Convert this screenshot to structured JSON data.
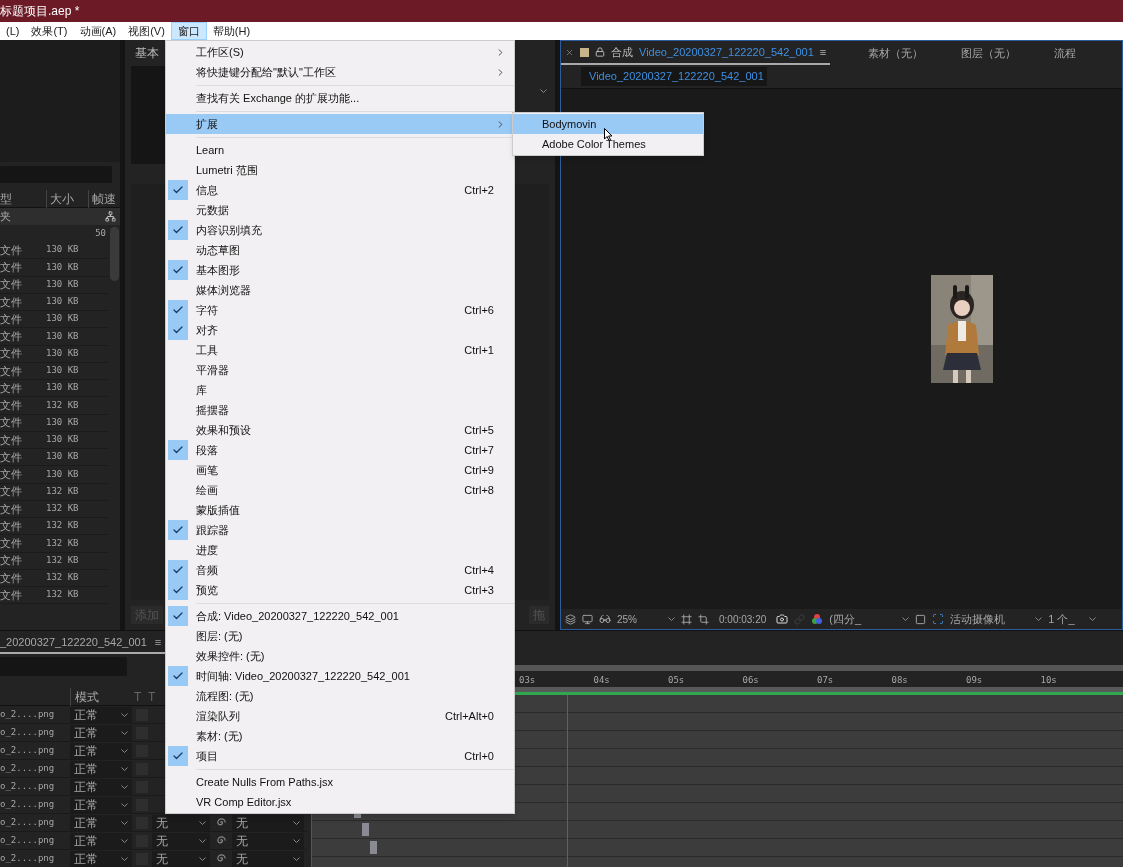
{
  "title_bar": {
    "title": "标题项目.aep *"
  },
  "menu_bar": [
    {
      "label": "(L)",
      "selected": false
    },
    {
      "label": "效果(T)",
      "selected": false
    },
    {
      "label": "动画(A)",
      "selected": false
    },
    {
      "label": "视图(V)",
      "selected": false
    },
    {
      "label": "窗口",
      "selected": true
    },
    {
      "label": "帮助(H)",
      "selected": false
    }
  ],
  "effects_panel": {
    "title": "基本",
    "button": "添加",
    "right_button": "拖"
  },
  "project_panel": {
    "columns": [
      "型",
      "大小",
      "帧速"
    ],
    "folder": "夹",
    "count": "50",
    "rows": [
      {
        "type": "文件",
        "size": "130 KB"
      },
      {
        "type": "文件",
        "size": "130 KB"
      },
      {
        "type": "文件",
        "size": "130 KB"
      },
      {
        "type": "文件",
        "size": "130 KB"
      },
      {
        "type": "文件",
        "size": "130 KB"
      },
      {
        "type": "文件",
        "size": "130 KB"
      },
      {
        "type": "文件",
        "size": "130 KB"
      },
      {
        "type": "文件",
        "size": "130 KB"
      },
      {
        "type": "文件",
        "size": "130 KB"
      },
      {
        "type": "文件",
        "size": "132 KB"
      },
      {
        "type": "文件",
        "size": "130 KB"
      },
      {
        "type": "文件",
        "size": "130 KB"
      },
      {
        "type": "文件",
        "size": "130 KB"
      },
      {
        "type": "文件",
        "size": "130 KB"
      },
      {
        "type": "文件",
        "size": "132 KB"
      },
      {
        "type": "文件",
        "size": "132 KB"
      },
      {
        "type": "文件",
        "size": "132 KB"
      },
      {
        "type": "文件",
        "size": "132 KB"
      },
      {
        "type": "文件",
        "size": "132 KB"
      },
      {
        "type": "文件",
        "size": "132 KB"
      },
      {
        "type": "文件",
        "size": "132 KB"
      }
    ]
  },
  "composition_panel": {
    "tab_label": "合成",
    "tab_name": "Video_20200327_122220_542_001",
    "menu_glyph": "≡",
    "other_tabs": [
      "素材（无）",
      "图层（无）",
      "流程"
    ],
    "breadcrumb": "Video_20200327_122220_542_001",
    "toolbar": {
      "zoom": "25%",
      "timecode": "0:00:03:20",
      "resolution": "(四分_",
      "camera": "活动摄像机",
      "views": "1 个_"
    }
  },
  "window_menu": {
    "items": [
      {
        "kind": "submenu",
        "label": "工作区(S)",
        "checked": false,
        "selected": false
      },
      {
        "kind": "submenu",
        "label": "将快捷键分配给\"默认\"工作区",
        "checked": false,
        "selected": false
      },
      {
        "kind": "separator"
      },
      {
        "kind": "item",
        "label": "查找有关 Exchange 的扩展功能...",
        "checked": false,
        "selected": false
      },
      {
        "kind": "separator"
      },
      {
        "kind": "submenu",
        "label": "扩展",
        "checked": false,
        "selected": true
      },
      {
        "kind": "separator"
      },
      {
        "kind": "item",
        "label": "Learn",
        "checked": false,
        "selected": false
      },
      {
        "kind": "item",
        "label": "Lumetri 范围",
        "checked": false,
        "selected": false
      },
      {
        "kind": "item",
        "label": "信息",
        "checked": true,
        "selected": false,
        "shortcut": "Ctrl+2"
      },
      {
        "kind": "item",
        "label": "元数据",
        "checked": false,
        "selected": false
      },
      {
        "kind": "item",
        "label": "内容识别填充",
        "checked": true,
        "selected": false
      },
      {
        "kind": "item",
        "label": "动态草图",
        "checked": false,
        "selected": false
      },
      {
        "kind": "item",
        "label": "基本图形",
        "checked": true,
        "selected": false
      },
      {
        "kind": "item",
        "label": "媒体浏览器",
        "checked": false,
        "selected": false
      },
      {
        "kind": "item",
        "label": "字符",
        "checked": true,
        "selected": false,
        "shortcut": "Ctrl+6"
      },
      {
        "kind": "item",
        "label": "对齐",
        "checked": true,
        "selected": false
      },
      {
        "kind": "item",
        "label": "工具",
        "checked": false,
        "selected": false,
        "shortcut": "Ctrl+1"
      },
      {
        "kind": "item",
        "label": "平滑器",
        "checked": false,
        "selected": false
      },
      {
        "kind": "item",
        "label": "库",
        "checked": false,
        "selected": false
      },
      {
        "kind": "item",
        "label": "摇摆器",
        "checked": false,
        "selected": false
      },
      {
        "kind": "item",
        "label": "效果和预设",
        "checked": false,
        "selected": false,
        "shortcut": "Ctrl+5"
      },
      {
        "kind": "item",
        "label": "段落",
        "checked": true,
        "selected": false,
        "shortcut": "Ctrl+7"
      },
      {
        "kind": "item",
        "label": "画笔",
        "checked": false,
        "selected": false,
        "shortcut": "Ctrl+9"
      },
      {
        "kind": "item",
        "label": "绘画",
        "checked": false,
        "selected": false,
        "shortcut": "Ctrl+8"
      },
      {
        "kind": "item",
        "label": "蒙版插值",
        "checked": false,
        "selected": false
      },
      {
        "kind": "item",
        "label": "跟踪器",
        "checked": true,
        "selected": false
      },
      {
        "kind": "item",
        "label": "进度",
        "checked": false,
        "selected": false
      },
      {
        "kind": "item",
        "label": "音频",
        "checked": true,
        "selected": false,
        "shortcut": "Ctrl+4"
      },
      {
        "kind": "item",
        "label": "预览",
        "checked": true,
        "selected": false,
        "shortcut": "Ctrl+3"
      },
      {
        "kind": "separator"
      },
      {
        "kind": "item",
        "label": "合成: Video_20200327_122220_542_001",
        "checked": true,
        "selected": false
      },
      {
        "kind": "item",
        "label": "图层: (无)",
        "checked": false,
        "selected": false
      },
      {
        "kind": "item",
        "label": "效果控件: (无)",
        "checked": false,
        "selected": false
      },
      {
        "kind": "item",
        "label": "时间轴: Video_20200327_122220_542_001",
        "checked": true,
        "selected": false
      },
      {
        "kind": "item",
        "label": "流程图: (无)",
        "checked": false,
        "selected": false
      },
      {
        "kind": "item",
        "label": "渲染队列",
        "checked": false,
        "selected": false,
        "shortcut": "Ctrl+Alt+0"
      },
      {
        "kind": "item",
        "label": "素材: (无)",
        "checked": false,
        "selected": false
      },
      {
        "kind": "item",
        "label": "项目",
        "checked": true,
        "selected": false,
        "shortcut": "Ctrl+0"
      },
      {
        "kind": "separator"
      },
      {
        "kind": "item",
        "label": "Create Nulls From Paths.jsx",
        "checked": false,
        "selected": false
      },
      {
        "kind": "item",
        "label": "VR Comp Editor.jsx",
        "checked": false,
        "selected": false
      }
    ]
  },
  "extensions_submenu": {
    "items": [
      {
        "label": "Bodymovin",
        "selected": true
      },
      {
        "label": "Adobe Color Themes",
        "selected": false
      }
    ]
  },
  "timeline": {
    "tab": "_20200327_122220_542_001",
    "menu_glyph": "≡",
    "columns": [
      "模式",
      "T",
      "T"
    ],
    "layers": [
      {
        "name": "o_2....png",
        "mode": "正常",
        "checked": false
      },
      {
        "name": "o_2....png",
        "mode": "正常",
        "checked": false
      },
      {
        "name": "o_2....png",
        "mode": "正常",
        "checked": false
      },
      {
        "name": "o_2....png",
        "mode": "正常",
        "checked": false
      },
      {
        "name": "o_2....png",
        "mode": "正常",
        "checked": false
      },
      {
        "name": "o_2....png",
        "mode": "正常",
        "checked": false
      },
      {
        "name": "o_2....png",
        "mode": "正常",
        "checked": false,
        "matte": "无",
        "parent": "无"
      },
      {
        "name": "o_2....png",
        "mode": "正常",
        "checked": false,
        "matte": "无",
        "parent": "无"
      },
      {
        "name": "o_2....png",
        "mode": "正常",
        "checked": false,
        "matte": "无",
        "parent": "无"
      }
    ],
    "ruler": [
      "03s",
      "04s",
      "05s",
      "06s",
      "07s",
      "08s",
      "09s",
      "10s"
    ]
  }
}
